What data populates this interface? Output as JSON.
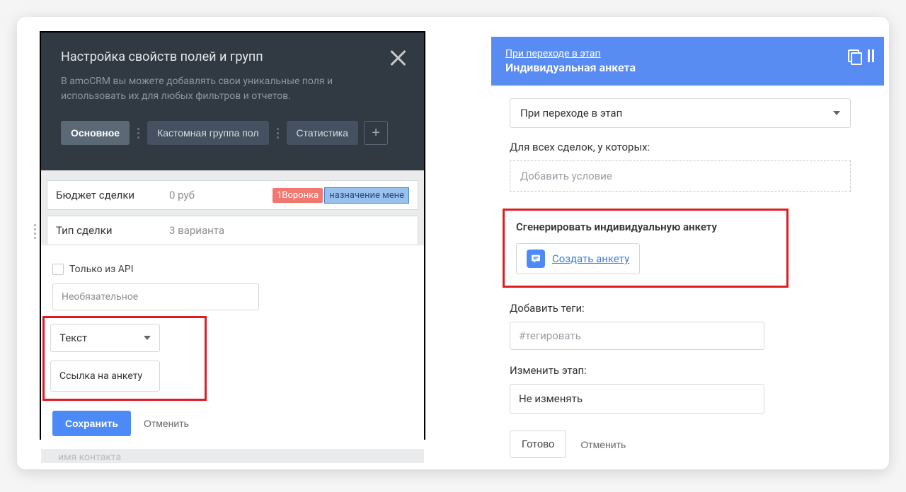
{
  "left": {
    "title": "Настройка свойств полей и групп",
    "subtext": "В amoCRM вы можете добавлять свои уникальные поля и использовать их для любых фильтров и отчетов.",
    "tabs": {
      "main": "Основное",
      "custom": "Кастомная группа пол",
      "stats": "Статистика"
    },
    "fields": {
      "budget_label": "Бюджет сделки",
      "budget_value": "0 руб",
      "badge_red": "1Воронка",
      "badge_blue": "назначение менe",
      "type_label": "Тип сделки",
      "type_value": "3 варианта"
    },
    "form": {
      "api_only": "Только из API",
      "optional_placeholder": "Необязательное",
      "select_type": "Текст",
      "link_field": "Ссылка на анкету",
      "save": "Сохранить",
      "cancel": "Отменить"
    },
    "bottom_hint": "имя контакта"
  },
  "right": {
    "header_link": "При переходе в этап",
    "header_title": "Индивидуальная анкета",
    "trigger_select": "При переходе в этап",
    "for_deals_label": "Для всех сделок, у которых:",
    "add_condition_placeholder": "Добавить условие",
    "generate_title": "Сгенерировать индивидуальную анкету",
    "create_link": "Создать анкету",
    "tags_label": "Добавить теги:",
    "tags_placeholder": "#тегировать",
    "stage_label": "Изменить этап:",
    "stage_value": "Не изменять",
    "done": "Готово",
    "cancel": "Отменить"
  }
}
